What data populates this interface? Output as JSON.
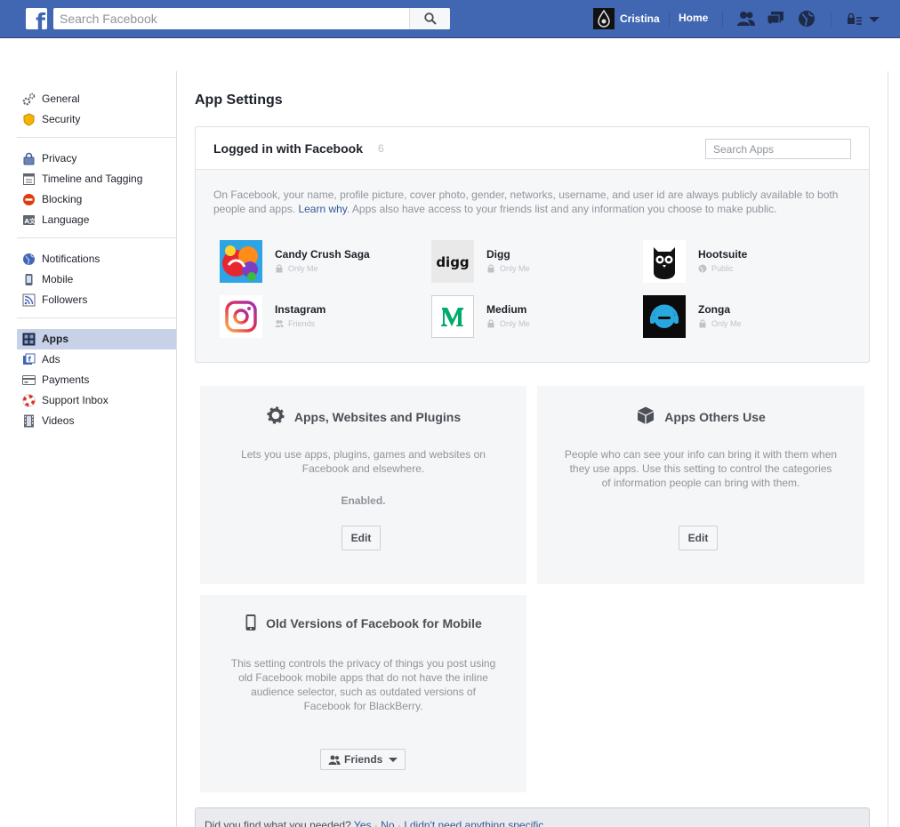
{
  "topbar": {
    "logo_letter": "f",
    "search_placeholder": "Search Facebook",
    "profile_name": "Cristina",
    "home_label": "Home"
  },
  "sidebar": {
    "groups": [
      [
        {
          "label": "General",
          "icon": "gears-icon"
        },
        {
          "label": "Security",
          "icon": "badge-icon"
        }
      ],
      [
        {
          "label": "Privacy",
          "icon": "lock-icon"
        },
        {
          "label": "Timeline and Tagging",
          "icon": "timeline-icon"
        },
        {
          "label": "Blocking",
          "icon": "block-icon"
        },
        {
          "label": "Language",
          "icon": "language-icon"
        }
      ],
      [
        {
          "label": "Notifications",
          "icon": "globe-icon"
        },
        {
          "label": "Mobile",
          "icon": "mobile-icon"
        },
        {
          "label": "Followers",
          "icon": "rss-icon"
        }
      ],
      [
        {
          "label": "Apps",
          "icon": "apps-icon",
          "active": true
        },
        {
          "label": "Ads",
          "icon": "ads-icon"
        },
        {
          "label": "Payments",
          "icon": "card-icon"
        },
        {
          "label": "Support Inbox",
          "icon": "lifebuoy-icon"
        },
        {
          "label": "Videos",
          "icon": "film-icon"
        }
      ]
    ]
  },
  "main": {
    "title": "App Settings",
    "apps_panel": {
      "title": "Logged in with Facebook",
      "count": "6",
      "search_placeholder": "Search Apps",
      "description_before": "On Facebook, your name, profile picture, cover photo, gender, networks, username, and user id are always publicly available to both people and apps.",
      "learn_why": "Learn why",
      "description_after": ". Apps also have access to your friends list and any information you choose to make public.",
      "apps": [
        {
          "name": "Candy Crush Saga",
          "privacy": "Only Me",
          "privacy_icon": "lock-icon"
        },
        {
          "name": "Digg",
          "privacy": "Only Me",
          "privacy_icon": "lock-icon",
          "logo_text": "digg"
        },
        {
          "name": "Hootsuite",
          "privacy": "Public",
          "privacy_icon": "globe-icon"
        },
        {
          "name": "Instagram",
          "privacy": "Friends",
          "privacy_icon": "friends-icon"
        },
        {
          "name": "Medium",
          "privacy": "Only Me",
          "privacy_icon": "lock-icon"
        },
        {
          "name": "Zonga",
          "privacy": "Only Me",
          "privacy_icon": "lock-icon"
        }
      ]
    },
    "cards": {
      "platform": {
        "title": "Apps, Websites and Plugins",
        "description": "Lets you use apps, plugins, games and websites on Facebook and elsewhere.",
        "status": "Enabled.",
        "button": "Edit"
      },
      "others": {
        "title": "Apps Others Use",
        "description": "People who can see your info can bring it with them when they use apps. Use this setting to control the categories of information people can bring with them.",
        "button": "Edit"
      },
      "old_mobile": {
        "title": "Old Versions of Facebook for Mobile",
        "description": "This setting controls the privacy of things you post using old Facebook mobile apps that do not have the inline audience selector, such as outdated versions of Facebook for BlackBerry.",
        "button": "Friends"
      }
    },
    "feedback": {
      "question": "Did you find what you needed?",
      "yes": "Yes",
      "no": "No",
      "other": "I didn't need anything specific",
      "separator": " · "
    }
  },
  "colors": {
    "topbar": "#4267b2",
    "active_item": "#c7d1e8",
    "link": "#365899"
  }
}
